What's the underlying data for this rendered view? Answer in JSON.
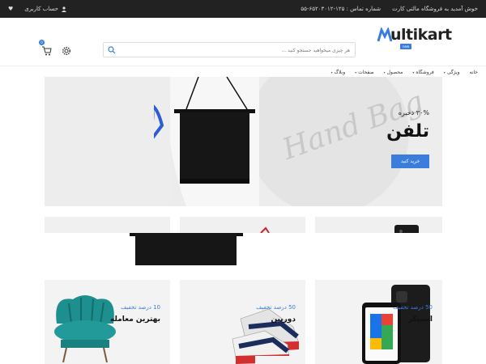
{
  "topbar": {
    "welcome": "خوش آمدید به فروشگاه مالتی کارت",
    "phone": "شماره تماس : ۱۲۵-۶۵۲۰۳۰۱۲-۵۵",
    "wishlist_glyph": "♥",
    "account_label": "حساب کاربری"
  },
  "header": {
    "logo_text": "ultikart",
    "logo_badge": "new",
    "search_placeholder": "هر چیزی میخواهید جستجو کنید ...",
    "cart_count": "0"
  },
  "nav": {
    "items": [
      {
        "label": "خانه",
        "chevron": ""
      },
      {
        "label": "ویژگی",
        "chevron": "▾"
      },
      {
        "label": "فروشگاه",
        "chevron": "▾"
      },
      {
        "label": "محصول",
        "chevron": "▾"
      },
      {
        "label": "صفحات",
        "chevron": "▾"
      },
      {
        "label": "وبلاگ",
        "chevron": "▾"
      }
    ]
  },
  "hero": {
    "save_text": "۳۰% ذخیره",
    "title": "تلفن",
    "button_label": "خرید کنید",
    "script_text": "Hand Bag"
  },
  "cards": [
    {
      "discount": "10 درصد تخفیف",
      "name": "بهترین معامله"
    },
    {
      "discount": "50 درصد تخفیف",
      "name": "دوربین"
    },
    {
      "discount": "50 درصد تخفیف",
      "name": "اسپیکر"
    }
  ],
  "colors": {
    "accent": "#3b7ddd",
    "topbar": "#222222",
    "hero_bg": "#ededed",
    "card_bg": "#f3f3f3"
  }
}
